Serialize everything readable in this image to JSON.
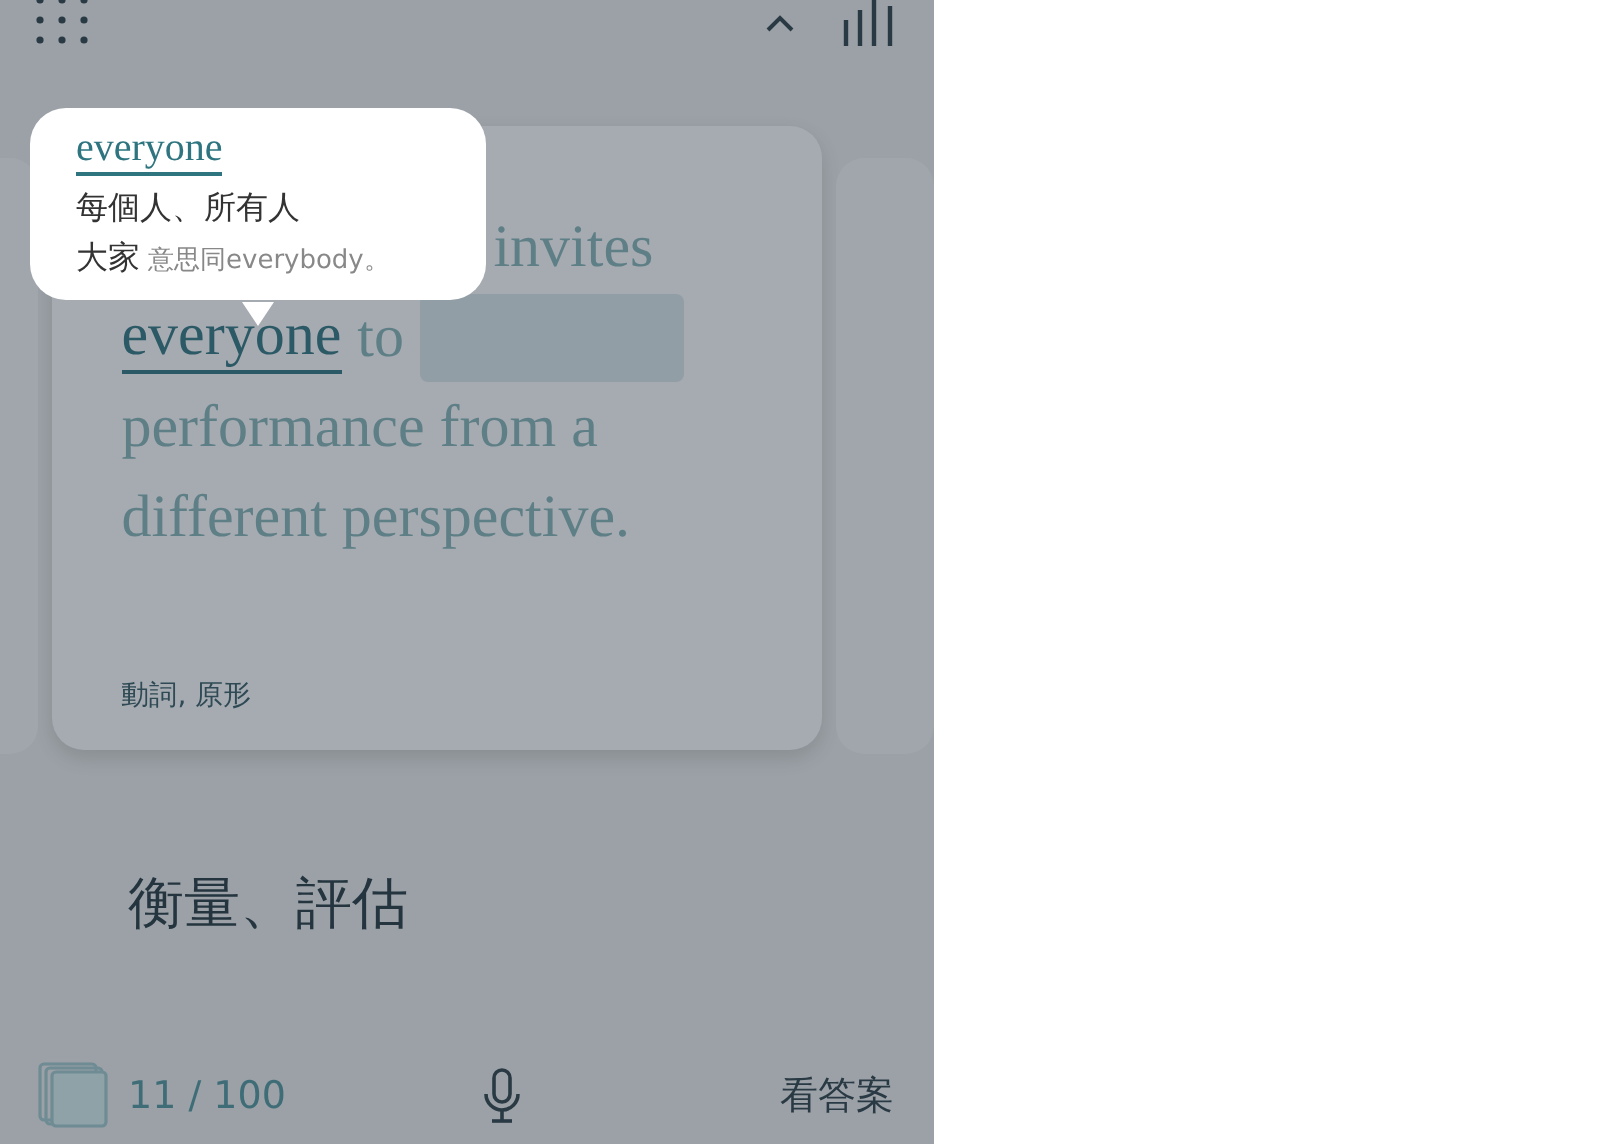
{
  "popup": {
    "word": "everyone",
    "meaning": "每個人、所有人",
    "example_word": "大家",
    "example_note": "意思同everybody。"
  },
  "card": {
    "lines": [
      [
        {
          "kind": "text",
          "text": "invites"
        }
      ],
      [
        {
          "kind": "target",
          "text": "everyone"
        },
        {
          "kind": "text",
          "text": "to"
        },
        {
          "kind": "blank"
        }
      ],
      [
        {
          "kind": "text",
          "text": "performance from a"
        }
      ],
      [
        {
          "kind": "text",
          "text": "different perspective."
        }
      ]
    ],
    "tag": "動詞, 原形"
  },
  "translation": "衡量、評估",
  "bottom_bar": {
    "counter": "11 / 100",
    "answer_button": "看答案"
  }
}
